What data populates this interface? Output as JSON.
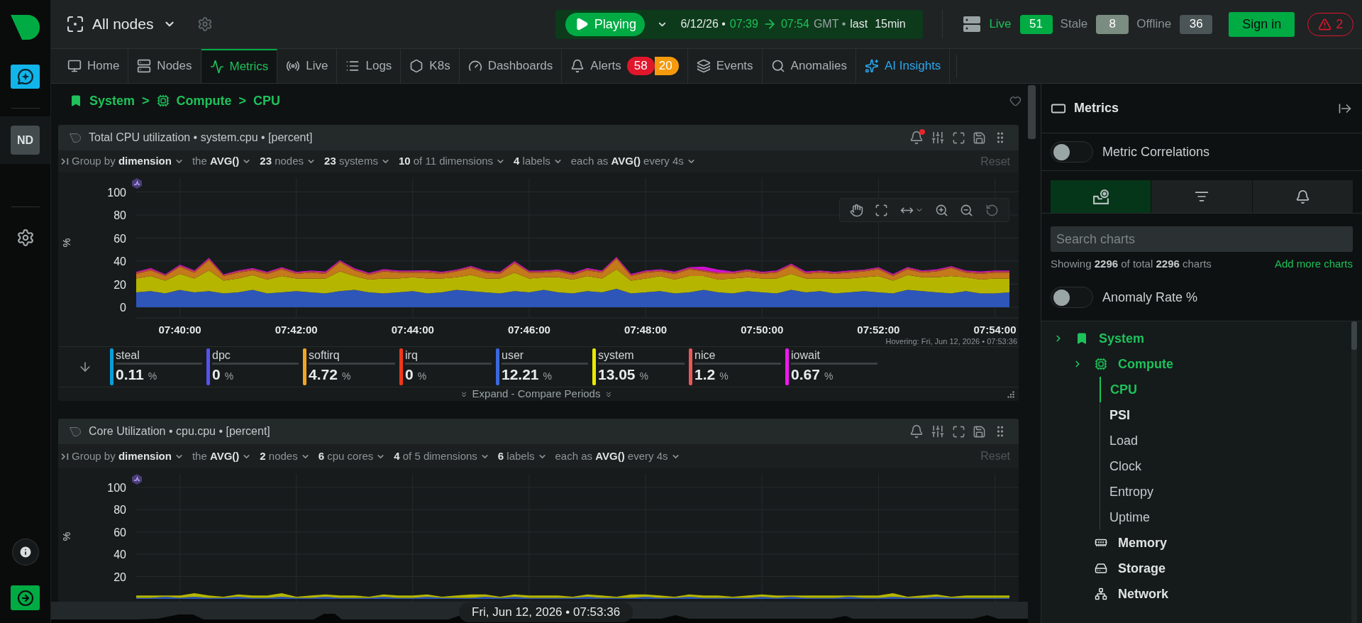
{
  "sidebar": {
    "avatar": "ND"
  },
  "topbar": {
    "scope": "All nodes",
    "playback": {
      "label": "Playing",
      "date": "6/12/26 •",
      "start": "07:39",
      "end": "07:54",
      "zone": "GMT •",
      "range_prefix": "last",
      "range": "15min"
    },
    "node_counts": [
      {
        "label": "Live",
        "count": "51",
        "kind": "live"
      },
      {
        "label": "Stale",
        "count": "8",
        "kind": "stale"
      },
      {
        "label": "Offline",
        "count": "36",
        "kind": "offline"
      }
    ],
    "sign_in": "Sign in",
    "alerts": "2"
  },
  "tabs": [
    {
      "label": "Home",
      "selected": false,
      "kind": "page"
    },
    {
      "label": "Nodes",
      "selected": false,
      "kind": "page"
    },
    {
      "label": "Metrics",
      "selected": true,
      "kind": "page"
    },
    {
      "label": "Live",
      "selected": false,
      "kind": "page"
    },
    {
      "label": "Logs",
      "selected": false,
      "kind": "page"
    },
    {
      "label": "K8s",
      "selected": false,
      "kind": "page"
    },
    {
      "label": "Dashboards",
      "selected": false,
      "kind": "page"
    },
    {
      "label": "Alerts",
      "selected": false,
      "kind": "page",
      "badges": [
        {
          "count": "58",
          "color": "#e0162b"
        },
        {
          "count": "20",
          "color": "#f59a0c"
        }
      ]
    },
    {
      "label": "Events",
      "selected": false,
      "kind": "page"
    },
    {
      "label": "Anomalies",
      "selected": false,
      "kind": "page"
    },
    {
      "label": "AI Insights",
      "selected": false,
      "kind": "assistant"
    }
  ],
  "breadcrumb": [
    {
      "label": "System"
    },
    {
      "separator": ">",
      "label": "Compute"
    },
    {
      "separator": ">",
      "label": "CPU"
    }
  ],
  "charts": [
    {
      "title": "Total CPU utilization • system.cpu • [percent]",
      "alert": true,
      "hovered": true,
      "filters": [
        "Group by **dimension**",
        "the **AVG()**",
        "**23** nodes",
        "**23** systems",
        "**10** of 11 dimensions",
        "**4** labels",
        "each as **AVG()** every 4s"
      ],
      "reset": {
        "label": "Reset",
        "disabled": true
      },
      "chart_data": {
        "type": "area",
        "stacked": true,
        "grid": true,
        "ylabel": "%",
        "ylim": [
          0,
          112
        ],
        "yticks": [
          0,
          20,
          40,
          60,
          80,
          100
        ],
        "categories": [
          null,
          null,
          null,
          "07:40:00",
          null,
          null,
          null,
          null,
          null,
          null,
          null,
          "07:42:00",
          null,
          null,
          null,
          null,
          null,
          null,
          null,
          "07:44:00",
          null,
          null,
          null,
          null,
          null,
          null,
          null,
          "07:46:00",
          null,
          null,
          null,
          null,
          null,
          null,
          null,
          "07:48:00",
          null,
          null,
          null,
          null,
          null,
          null,
          null,
          "07:50:00",
          null,
          null,
          null,
          null,
          null,
          null,
          null,
          "07:52:00",
          null,
          null,
          null,
          null,
          null,
          null,
          null,
          "07:54:00",
          null
        ],
        "series": [
          {
            "color": "#2d56b8",
            "values": [
              13,
              14,
              12,
              15,
              13,
              14,
              12,
              13,
              15,
              12,
              13,
              14,
              13,
              12,
              14,
              15,
              13,
              12,
              13,
              14,
              12,
              13,
              15,
              14,
              13,
              12,
              14,
              13,
              15,
              13,
              12,
              14,
              13,
              16,
              12,
              13,
              14,
              12,
              13,
              15,
              13,
              12,
              14,
              13,
              12,
              15,
              13,
              14,
              12,
              13,
              14,
              13,
              12,
              15,
              14,
              13,
              12,
              14,
              12,
              12,
              13
            ]
          },
          {
            "color": "#b5b500",
            "values": [
              12,
              13,
              11,
              14,
              12,
              18,
              11,
              12,
              13,
              12,
              14,
              11,
              12,
              13,
              17,
              12,
              11,
              13,
              12,
              12,
              13,
              12,
              11,
              14,
              12,
              13,
              16,
              12,
              11,
              13,
              12,
              13,
              12,
              17,
              11,
              12,
              13,
              12,
              14,
              12,
              11,
              13,
              12,
              12,
              13,
              14,
              12,
              11,
              13,
              12,
              12,
              14,
              11,
              13,
              12,
              13,
              15,
              12,
              12,
              13,
              12
            ]
          },
          {
            "color": "#c4791b",
            "values": [
              4,
              5,
              4,
              6,
              5,
              9,
              4,
              5,
              4,
              5,
              6,
              4,
              5,
              4,
              8,
              5,
              4,
              6,
              5,
              4,
              5,
              4,
              5,
              6,
              5,
              4,
              8,
              5,
              4,
              5,
              4,
              5,
              5,
              9,
              4,
              5,
              4,
              5,
              6,
              4,
              5,
              4,
              5,
              4,
              5,
              7,
              4,
              5,
              4,
              5,
              5,
              6,
              4,
              5,
              4,
              5,
              7,
              4,
              5,
              5,
              5
            ]
          },
          {
            "color": "#c2453f",
            "values": [
              1.2,
              1.3,
              1.1,
              1.2,
              1.4,
              1.2,
              1.1,
              1.2,
              1.3,
              1.2,
              1.1,
              1.2,
              1.2,
              1.3,
              1.2,
              1.1,
              1.2,
              1.4,
              1.2,
              1.2,
              1.3,
              1.2,
              1.1,
              1.2,
              1.2,
              1.3,
              1.2,
              1.1,
              1.2,
              1.2,
              1.2,
              1.3,
              1.2,
              1.1,
              1.2,
              1.2,
              1.4,
              1.2,
              1.1,
              1.2,
              1.2,
              1.2,
              1.3,
              1.2,
              1.1,
              1.2,
              1.2,
              1.3,
              1.2,
              1.2,
              1.1,
              1.2,
              1.2,
              1.3,
              1.2,
              1.2,
              1.1,
              1.2,
              1.3,
              1.2,
              1.2
            ]
          },
          {
            "color": "#d010d0",
            "values": [
              0.6,
              0.7,
              0.6,
              0.8,
              0.6,
              0.7,
              0.6,
              0.6,
              0.7,
              0.6,
              0.7,
              0.6,
              0.6,
              0.7,
              0.6,
              0.8,
              0.6,
              0.7,
              0.6,
              0.6,
              0.7,
              0.6,
              0.6,
              0.7,
              0.6,
              0.6,
              0.8,
              0.6,
              0.7,
              0.6,
              0.6,
              0.7,
              0.6,
              0.6,
              0.7,
              0.6,
              0.6,
              0.7,
              0.6,
              3,
              2.5,
              0.7,
              0.6,
              0.6,
              0.7,
              0.6,
              0.8,
              0.6,
              0.6,
              0.7,
              0.6,
              0.6,
              0.7,
              0.6,
              0.6,
              0.7,
              0.6,
              0.6,
              0.7,
              0.7,
              0.6
            ]
          }
        ]
      },
      "hover": "Hovering: Fri, Jun 12, 2026 • 07:53:36",
      "legend": [
        {
          "name": "steal",
          "value": "0.11",
          "unit": "%",
          "color": "#0a9fd8"
        },
        {
          "name": "dpc",
          "value": "0",
          "unit": "%",
          "color": "#5454ec"
        },
        {
          "name": "softirq",
          "value": "4.72",
          "unit": "%",
          "color": "#f5a524"
        },
        {
          "name": "irq",
          "value": "0",
          "unit": "%",
          "color": "#f0381a"
        },
        {
          "name": "user",
          "value": "12.21",
          "unit": "%",
          "color": "#3b68dc"
        },
        {
          "name": "system",
          "value": "13.05",
          "unit": "%",
          "color": "#e8e800"
        },
        {
          "name": "nice",
          "value": "1.2",
          "unit": "%",
          "color": "#ec5656"
        },
        {
          "name": "iowait",
          "value": "0.67",
          "unit": "%",
          "color": "#f018f0"
        }
      ],
      "expand": "Expand - Compare Periods"
    },
    {
      "title": "Core Utilization • cpu.cpu • [percent]",
      "alert": false,
      "hovered": false,
      "filters": [
        "Group by **dimension**",
        "the **AVG()**",
        "**2** nodes",
        "**6** cpu cores",
        "**4** of 5 dimensions",
        "**6** labels",
        "each as **AVG()** every 4s"
      ],
      "reset": {
        "label": "Reset",
        "disabled": true
      },
      "chart_data": {
        "type": "area",
        "stacked": true,
        "grid": true,
        "ylabel": "%",
        "ylim": [
          0,
          112
        ],
        "yticks": [
          20,
          40,
          60,
          80,
          100
        ],
        "series": [
          {
            "color": "#2d56b8",
            "values": [
              1,
              1,
              2,
              1,
              2,
              1,
              1,
              2,
              1,
              1,
              2,
              1,
              1,
              2,
              1,
              1,
              1,
              2,
              1,
              1,
              2,
              1,
              1,
              1,
              2,
              1,
              2,
              1,
              1,
              1,
              1,
              2,
              1,
              1,
              1,
              2,
              1,
              1,
              2,
              1,
              1,
              1,
              1,
              2,
              1,
              2,
              1,
              1,
              1,
              2,
              1,
              1,
              2,
              1,
              1,
              2,
              1,
              1,
              1,
              1,
              1
            ]
          },
          {
            "color": "#b5b500",
            "values": [
              2,
              2,
              1,
              2,
              3,
              2,
              1,
              2,
              2,
              2,
              3,
              1,
              2,
              2,
              2,
              2,
              1,
              2,
              2,
              2,
              2,
              1,
              2,
              3,
              2,
              1,
              2,
              2,
              2,
              2,
              1,
              2,
              2,
              1,
              3,
              2,
              2,
              1,
              2,
              2,
              2,
              1,
              2,
              2,
              2,
              1,
              2,
              2,
              2,
              1,
              2,
              2,
              3,
              1,
              2,
              2,
              1,
              2,
              2,
              2,
              2
            ]
          }
        ]
      }
    }
  ],
  "timeline": {
    "time": "Fri, Jun 12, 2026 • 07:53:36"
  },
  "panel": {
    "title": "Metrics",
    "correlations": {
      "label": "Metric Correlations",
      "on": false
    },
    "tabs": [
      {
        "selected": true
      },
      {
        "selected": false
      },
      {
        "selected": false
      }
    ],
    "search": {
      "placeholder": "Search charts"
    },
    "summary": "Showing **2296** of total **2296** charts",
    "add_link": "Add more charts",
    "anomaly": {
      "label": "Anomaly Rate %",
      "on": false
    },
    "tree": [
      {
        "label": "System",
        "selected": false,
        "expanded": true,
        "children": [
          {
            "label": "Compute",
            "selected": false,
            "expanded": true,
            "children": [
              {
                "label": "CPU",
                "selected": true,
                "kind": "group"
              },
              {
                "label": "PSI",
                "selected": false,
                "kind": "group"
              },
              {
                "label": "Load",
                "selected": false,
                "kind": "leaf"
              },
              {
                "label": "Clock",
                "selected": false,
                "kind": "leaf"
              },
              {
                "label": "Entropy",
                "selected": false,
                "kind": "leaf"
              },
              {
                "label": "Uptime",
                "selected": false,
                "kind": "leaf"
              }
            ]
          },
          {
            "label": "Memory",
            "selected": false,
            "expanded": false
          },
          {
            "label": "Storage",
            "selected": false,
            "expanded": false
          },
          {
            "label": "Network",
            "selected": false,
            "expanded": false
          }
        ]
      }
    ]
  }
}
